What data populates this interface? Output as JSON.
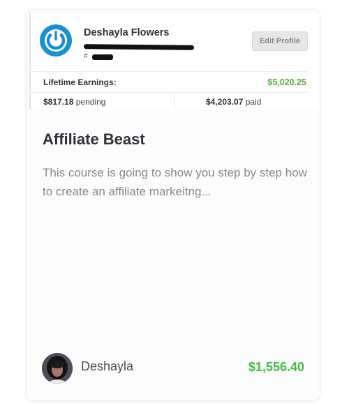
{
  "profile": {
    "name": "Deshayla Flowers",
    "id_prefix": "#",
    "edit_button": "Edit Profile",
    "lifetime_label": "Lifetime Earnings:",
    "lifetime_value": "$5,020.25",
    "pending_amount": "$817.18",
    "pending_label": "pending",
    "paid_amount": "$4,203.07",
    "paid_label": "paid",
    "icons": {
      "logo": "power-logo-icon"
    }
  },
  "course": {
    "title": "Affiliate Beast",
    "description": "This course is going to show you step by step how to create an affiliate markeitng..."
  },
  "footer": {
    "author": "Deshayla",
    "price": "$1,556.40"
  },
  "colors": {
    "logo_blue": "#1a8fd6",
    "earnings_green": "#5aaa3c",
    "price_green": "#3fbf3f",
    "title_text": "#2e3338",
    "muted_text": "#858a8e"
  }
}
